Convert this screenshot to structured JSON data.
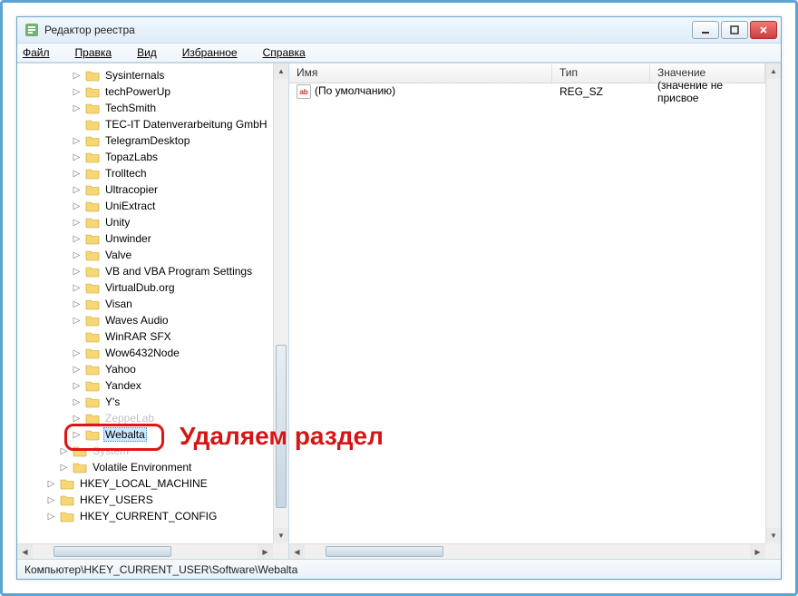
{
  "window": {
    "title": "Редактор реестра"
  },
  "menu": {
    "file": "Файл",
    "edit": "Правка",
    "view": "Вид",
    "favorites": "Избранное",
    "help": "Справка"
  },
  "tree": {
    "items": [
      {
        "indent": 4,
        "exp": true,
        "label": "Sysinternals"
      },
      {
        "indent": 4,
        "exp": true,
        "label": "techPowerUp"
      },
      {
        "indent": 4,
        "exp": true,
        "label": "TechSmith"
      },
      {
        "indent": 4,
        "exp": false,
        "label": "TEC-IT Datenverarbeitung GmbH"
      },
      {
        "indent": 4,
        "exp": true,
        "label": "TelegramDesktop"
      },
      {
        "indent": 4,
        "exp": true,
        "label": "TopazLabs"
      },
      {
        "indent": 4,
        "exp": true,
        "label": "Trolltech"
      },
      {
        "indent": 4,
        "exp": true,
        "label": "Ultracopier"
      },
      {
        "indent": 4,
        "exp": true,
        "label": "UniExtract"
      },
      {
        "indent": 4,
        "exp": true,
        "label": "Unity"
      },
      {
        "indent": 4,
        "exp": true,
        "label": "Unwinder"
      },
      {
        "indent": 4,
        "exp": true,
        "label": "Valve"
      },
      {
        "indent": 4,
        "exp": true,
        "label": "VB and VBA Program Settings"
      },
      {
        "indent": 4,
        "exp": true,
        "label": "VirtualDub.org"
      },
      {
        "indent": 4,
        "exp": true,
        "label": "Visan"
      },
      {
        "indent": 4,
        "exp": true,
        "label": "Waves Audio"
      },
      {
        "indent": 4,
        "exp": false,
        "label": "WinRAR SFX"
      },
      {
        "indent": 4,
        "exp": true,
        "label": "Wow6432Node"
      },
      {
        "indent": 4,
        "exp": true,
        "label": "Yahoo"
      },
      {
        "indent": 4,
        "exp": true,
        "label": "Yandex"
      },
      {
        "indent": 4,
        "exp": true,
        "label": "Y's"
      },
      {
        "indent": 4,
        "exp": true,
        "label": "ZeppeLab",
        "obscured": true
      },
      {
        "indent": 4,
        "exp": true,
        "label": "Webalta",
        "selected": true
      },
      {
        "indent": 3,
        "exp": true,
        "label": "System",
        "obscured": true
      },
      {
        "indent": 3,
        "exp": true,
        "label": "Volatile Environment"
      },
      {
        "indent": 2,
        "exp": true,
        "label": "HKEY_LOCAL_MACHINE"
      },
      {
        "indent": 2,
        "exp": true,
        "label": "HKEY_USERS"
      },
      {
        "indent": 2,
        "exp": true,
        "label": "HKEY_CURRENT_CONFIG"
      }
    ]
  },
  "list": {
    "headers": {
      "name": "Имя",
      "type": "Тип",
      "value": "Значение"
    },
    "rows": [
      {
        "name": "(По умолчанию)",
        "type": "REG_SZ",
        "value": "(значение не присвое"
      }
    ]
  },
  "statusbar": "Компьютер\\HKEY_CURRENT_USER\\Software\\Webalta",
  "annotation": "Удаляем раздел"
}
